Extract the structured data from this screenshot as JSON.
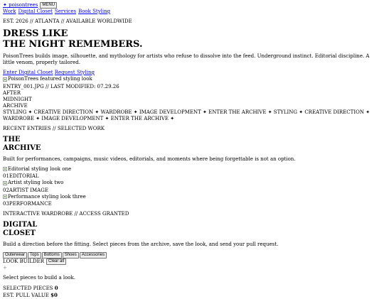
{
  "header": {
    "brand_icon": "✦",
    "brand": "poisontrees",
    "menu_label": "MENU",
    "nav": [
      "Work",
      "Digital Closet",
      "Services",
      "Book Styling"
    ]
  },
  "meta_line": "EST. 2026 // ATLANTA // AVAILABLE WORLDWIDE",
  "hero": {
    "title_line1": "DRESS LIKE",
    "title_line2": "THE NIGHT REMEMBERS.",
    "description": "PoisonTrees builds image, silhouette, and mythology for artists who refuse to dissolve into the feed. Underground instinct. Editorial discipline. A little venom, properly tailored.",
    "cta_closet": "Enter Digital Closet",
    "cta_request": "Request Styling"
  },
  "featured": {
    "alt": "PoisonTrees featured styling look",
    "entry": "ENTRY_001.JPG // LAST MODIFIED: 07.29.26",
    "stack": [
      "AFTER",
      "MIDNIGHT",
      "ARCHIVE"
    ]
  },
  "ticker": "STYLING ✦ CREATIVE DIRECTION ✦ WARDROBE ✦ IMAGE DEVELOPMENT ✦ ENTER THE ARCHIVE ✦ STYLING ✦ CREATIVE DIRECTION ✦ WARDROBE ✦ IMAGE DEVELOPMENT ✦ ENTER THE ARCHIVE ✦",
  "archive": {
    "eyebrow": "RECENT ENTRIES // SELECTED WORK",
    "title_line1": "THE",
    "title_line2": "ARCHIVE",
    "description": "Built for performances, campaigns, music videos, editorials, and moments where being forgettable is not an option.",
    "entries": [
      {
        "alt": "Editorial styling look one",
        "number": "01",
        "label": "EDITORIAL"
      },
      {
        "alt": "Artist styling look two",
        "number": "02",
        "label": "ARTIST IMAGE"
      },
      {
        "alt": "Performance styling look three",
        "number": "03",
        "label": "PERFORMANCE"
      }
    ]
  },
  "closet": {
    "eyebrow": "INTERACTIVE WARDROBE // ACCESS GRANTED",
    "title_line1": "DIGITAL",
    "title_line2": "CLOSET",
    "description": "Build a direction before the fitting. Select pieces from the archive, save the look, and send your pull request.",
    "filters": [
      "Outerwear",
      "Tops",
      "Bottoms",
      "Shoes",
      "Accessories"
    ],
    "builder_label": "LOOK BUILDER",
    "clear_label": "Clear all",
    "plus": "+",
    "empty_text": "Select pieces to build a look.",
    "selected_label": "SELECTED PIECES",
    "selected_count": "0",
    "pull_label": "EST. PULL VALUE",
    "pull_value": "$0"
  }
}
